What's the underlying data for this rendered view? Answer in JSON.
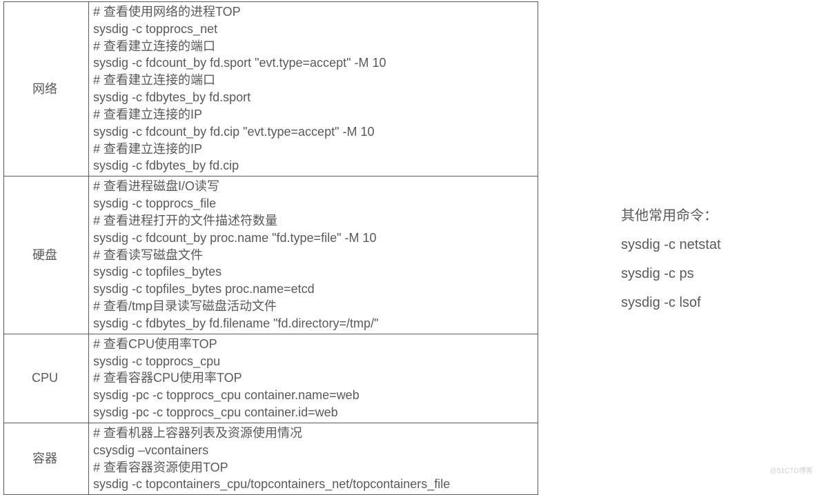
{
  "table": {
    "rows": [
      {
        "label": "网络",
        "lines": [
          "# 查看使用网络的进程TOP",
          "sysdig -c topprocs_net",
          "# 查看建立连接的端口",
          "sysdig -c fdcount_by fd.sport \"evt.type=accept\" -M 10",
          "# 查看建立连接的端口",
          "sysdig -c fdbytes_by fd.sport",
          "# 查看建立连接的IP",
          "sysdig -c fdcount_by fd.cip \"evt.type=accept\" -M 10",
          "# 查看建立连接的IP",
          "sysdig -c fdbytes_by fd.cip"
        ]
      },
      {
        "label": "硬盘",
        "lines": [
          "# 查看进程磁盘I/O读写",
          "sysdig -c topprocs_file",
          "# 查看进程打开的文件描述符数量",
          "sysdig -c fdcount_by proc.name \"fd.type=file\" -M 10",
          "# 查看读写磁盘文件",
          "sysdig -c topfiles_bytes",
          "sysdig -c topfiles_bytes proc.name=etcd",
          "# 查看/tmp目录读写磁盘活动文件",
          "sysdig -c fdbytes_by fd.filename \"fd.directory=/tmp/\""
        ]
      },
      {
        "label": "CPU",
        "lines": [
          "# 查看CPU使用率TOP",
          "sysdig -c topprocs_cpu",
          "# 查看容器CPU使用率TOP",
          "sysdig -pc -c topprocs_cpu container.name=web",
          "sysdig -pc -c topprocs_cpu container.id=web"
        ]
      },
      {
        "label": "容器",
        "lines": [
          "# 查看机器上容器列表及资源使用情况",
          "csysdig –vcontainers",
          "# 查看容器资源使用TOP",
          "sysdig -c topcontainers_cpu/topcontainers_net/topcontainers_file"
        ]
      }
    ]
  },
  "sidebar": {
    "title": "其他常用命令：",
    "commands": [
      "sysdig -c netstat",
      "sysdig -c ps",
      "sysdig -c lsof"
    ]
  },
  "watermark": "@51CTO博客"
}
